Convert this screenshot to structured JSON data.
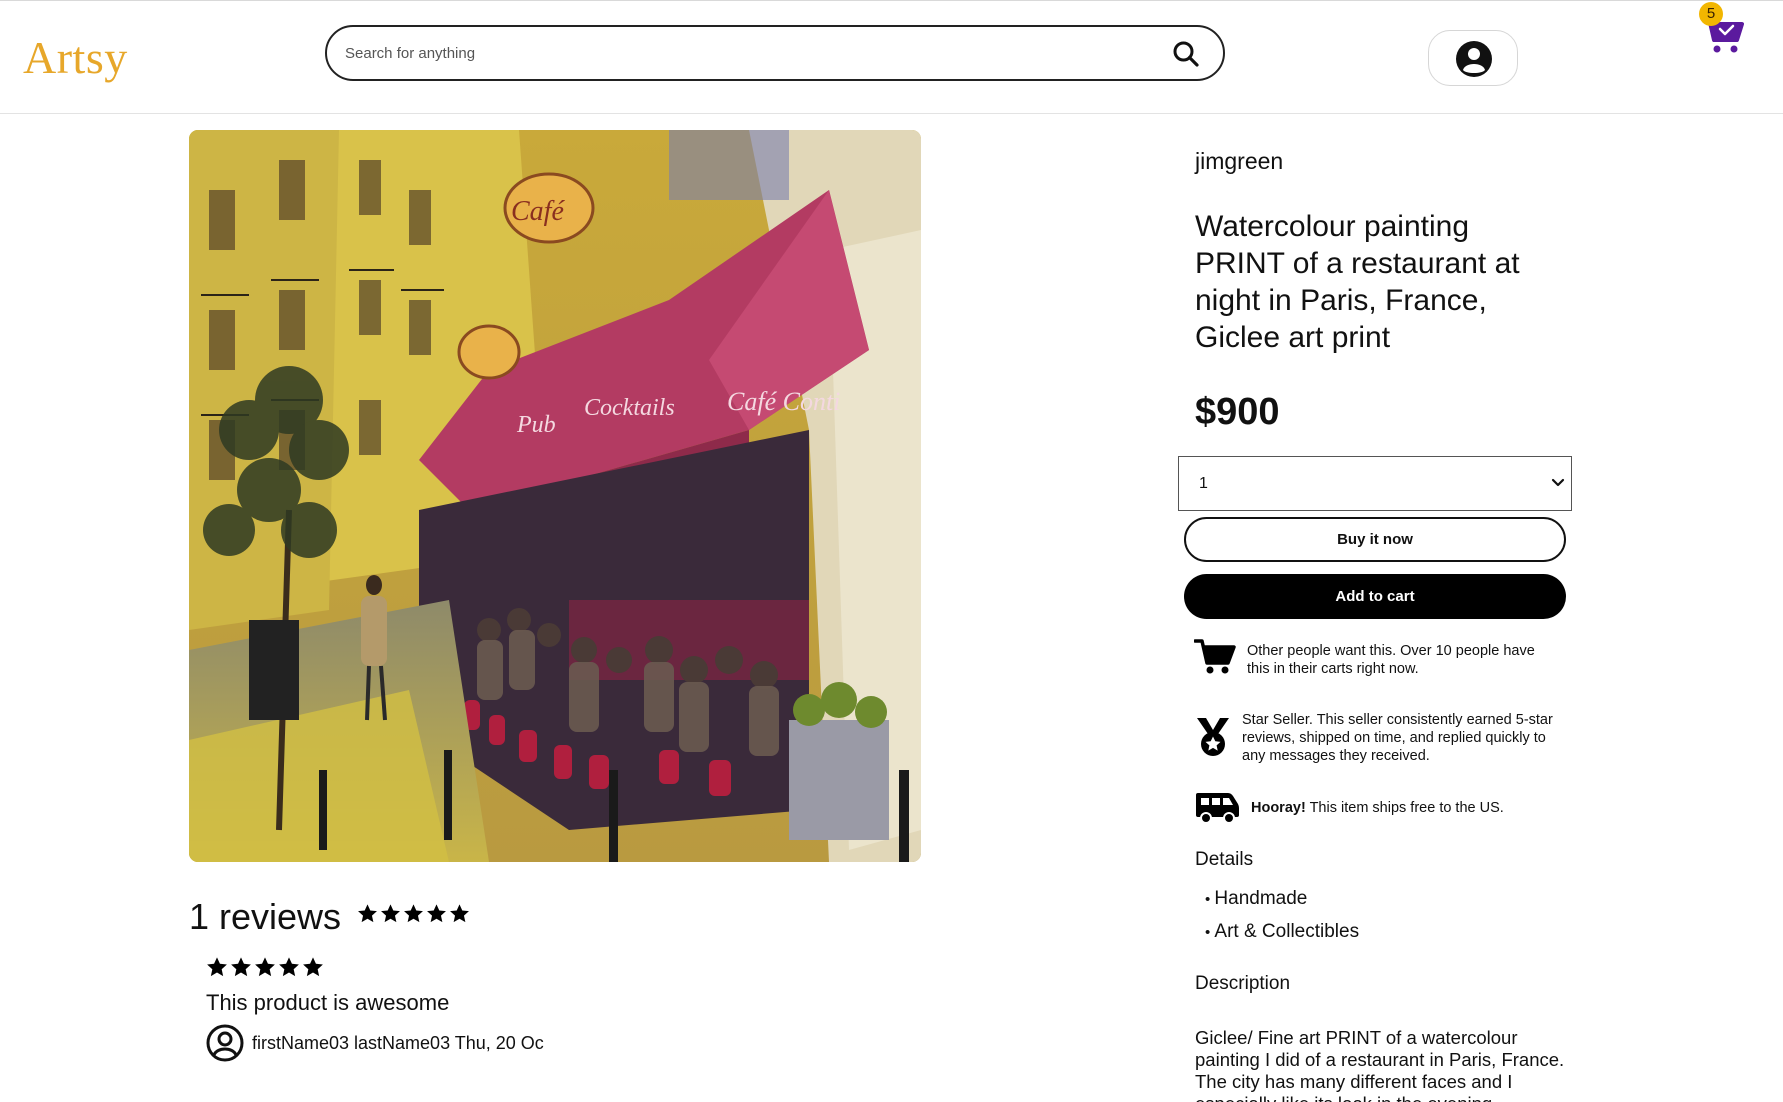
{
  "header": {
    "logo": "Artsy",
    "search_placeholder": "Search for anything",
    "cart_count": "5"
  },
  "product": {
    "seller": "jimgreen",
    "title": "Watercolour painting PRINT of a restaurant at night in Paris, France, Giclee art print",
    "price": "$900",
    "quantity": "1",
    "buy_label": "Buy it now",
    "add_label": "Add to cart",
    "image": {
      "signs": [
        "Café",
        "Pub",
        "Cocktails",
        "Café Conti"
      ]
    }
  },
  "highlights": [
    {
      "icon": "cart-icon",
      "text": "Other people want this. Over 10 people have this in their carts right now."
    },
    {
      "icon": "medal-icon",
      "text": "Star Seller. This seller consistently earned 5-star reviews, shipped on time, and replied quickly to any messages they received."
    },
    {
      "icon": "truck-icon",
      "bold": "Hooray!",
      "text": "This item ships free to the US."
    }
  ],
  "details": {
    "heading": "Details",
    "items": [
      "Handmade",
      "Art & Collectibles"
    ]
  },
  "description": {
    "heading": "Description",
    "text": "Giclee/ Fine art PRINT of a watercolour painting I did of a restaurant in Paris, France. The city has many different faces and I especially like its look in the evening"
  },
  "reviews": {
    "title": "1 reviews",
    "average_rating": 5,
    "items": [
      {
        "rating": 5,
        "text": "This product is awesome",
        "author": "firstName03 lastName03 Thu, 20 Oc"
      }
    ]
  },
  "colors": {
    "logo": "#e7a72a",
    "cart": "#5b1a9e",
    "badge": "#f2b600",
    "primary_button": "#000000"
  }
}
